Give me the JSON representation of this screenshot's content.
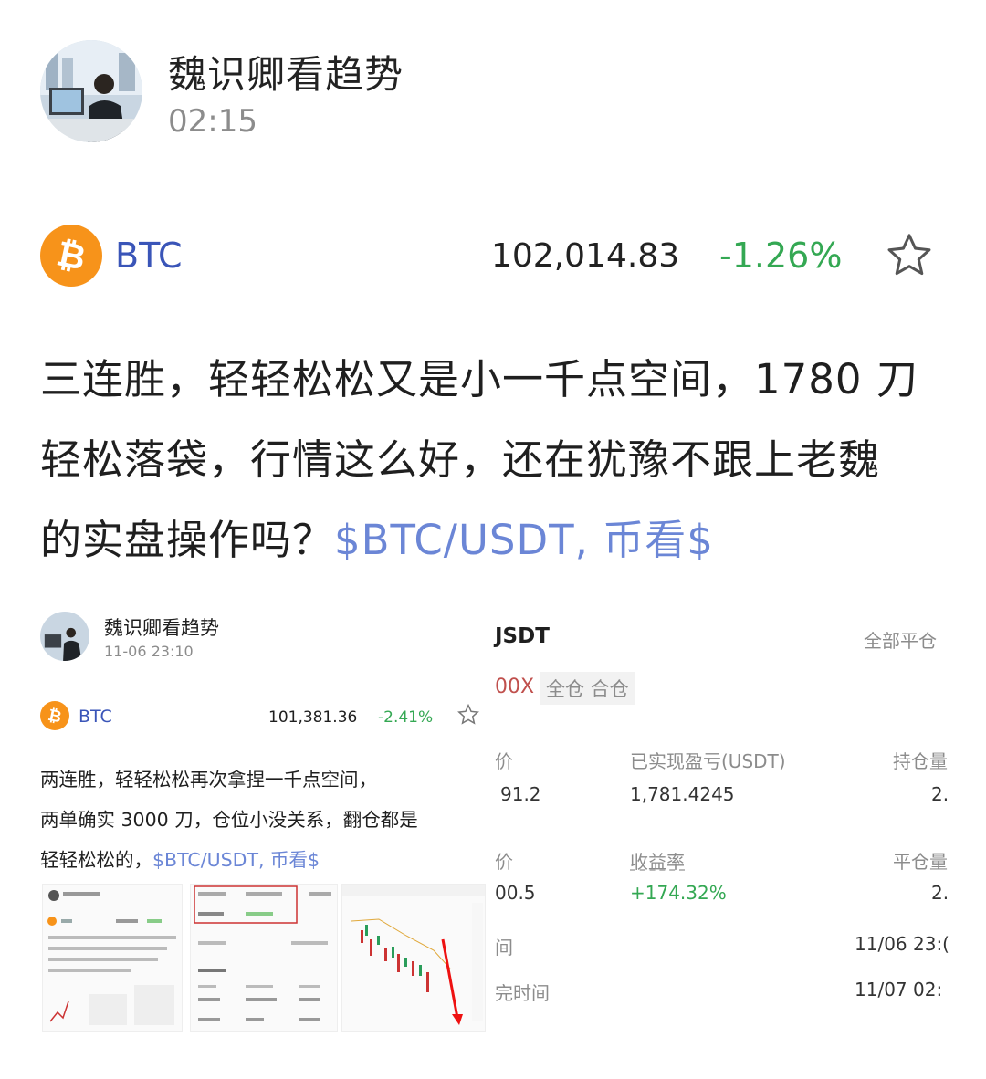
{
  "post": {
    "author": "魏识卿看趋势",
    "time": "02:15",
    "ticker": {
      "symbol": "BTC",
      "price": "102,014.83",
      "change": "-1.26%"
    },
    "text_lines": [
      "三连胜，轻轻松松又是小一千点空间，1780 刀",
      "轻松落袋，行情这么好，还在犹豫不跟上老魏",
      "的实盘操作吗？"
    ],
    "tags": "$BTC/USDT, 币看$"
  },
  "embedded": {
    "author": "魏识卿看趋势",
    "time": "11-06 23:10",
    "ticker": {
      "symbol": "BTC",
      "price": "101,381.36",
      "change": "-2.41%"
    },
    "text_lines": [
      "两连胜，轻轻松松再次拿捏一千点空间，",
      "两单确实 3000 刀，仓位小没关系，翻仓都是",
      "轻轻松松的，"
    ],
    "tags": "$BTC/USDT, 币看$",
    "right_panel": {
      "pair": "JSDT",
      "close_all": "全部平仓",
      "leverage": "00X",
      "mode": "全仓 合仓",
      "labels": {
        "entry": "价",
        "realized_pnl": "已实现盈亏(USDT)",
        "hold_qty": "持仓量",
        "exit": "价",
        "roi": "收益率",
        "close_qty": "平仓量",
        "open_time": "间",
        "close_time": "完时间"
      },
      "values": {
        "entry": "91.2",
        "realized_pnl": "1,781.4245",
        "hold_qty": "2.",
        "exit": "00.5",
        "roi": "+174.32%",
        "close_qty": "2.",
        "open_time": "11/06 23:(",
        "close_time": "11/07 02:"
      }
    }
  }
}
